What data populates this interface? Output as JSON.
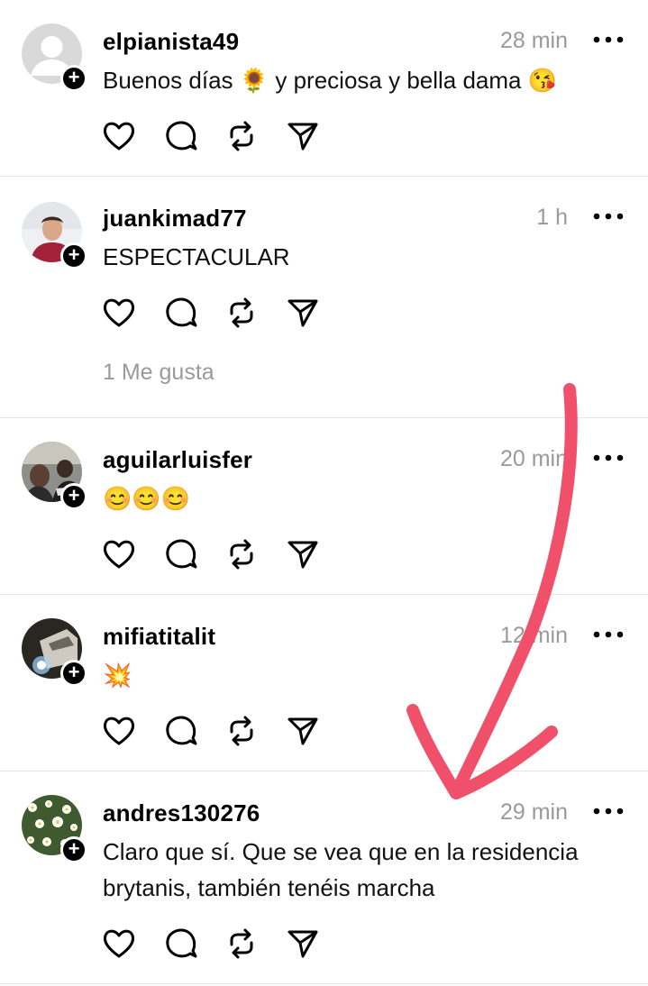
{
  "posts": [
    {
      "username": "elpianista49",
      "time": "28 min",
      "text": "Buenos días 🌻 y preciosa y bella dama 😘",
      "avatar": "default-avatar"
    },
    {
      "username": "juankimad77",
      "time": "1 h",
      "text": "ESPECTACULAR",
      "likes": "1 Me gusta",
      "avatar": "photo-avatar-man"
    },
    {
      "username": "aguilarluisfer",
      "time": "20 min",
      "text": "😊😊😊",
      "avatar": "photo-avatar-dark"
    },
    {
      "username": "mifiatitalit",
      "time": "12 min",
      "text": "💥",
      "avatar": "photo-avatar-night"
    },
    {
      "username": "andres130276",
      "time": "29 min",
      "text": "Claro que sí. Que se vea que en la residencia brytanis, también tenéis marcha",
      "avatar": "photo-avatar-flowers"
    }
  ],
  "icons": {
    "like": "heart-icon",
    "comment": "comment-icon",
    "repost": "repost-icon",
    "share": "send-icon",
    "more": "more-icon",
    "follow": "plus-icon"
  },
  "colors": {
    "annotation": "#f0506a",
    "meta_text": "#9a9a9a",
    "divider": "#e6e6e6"
  }
}
